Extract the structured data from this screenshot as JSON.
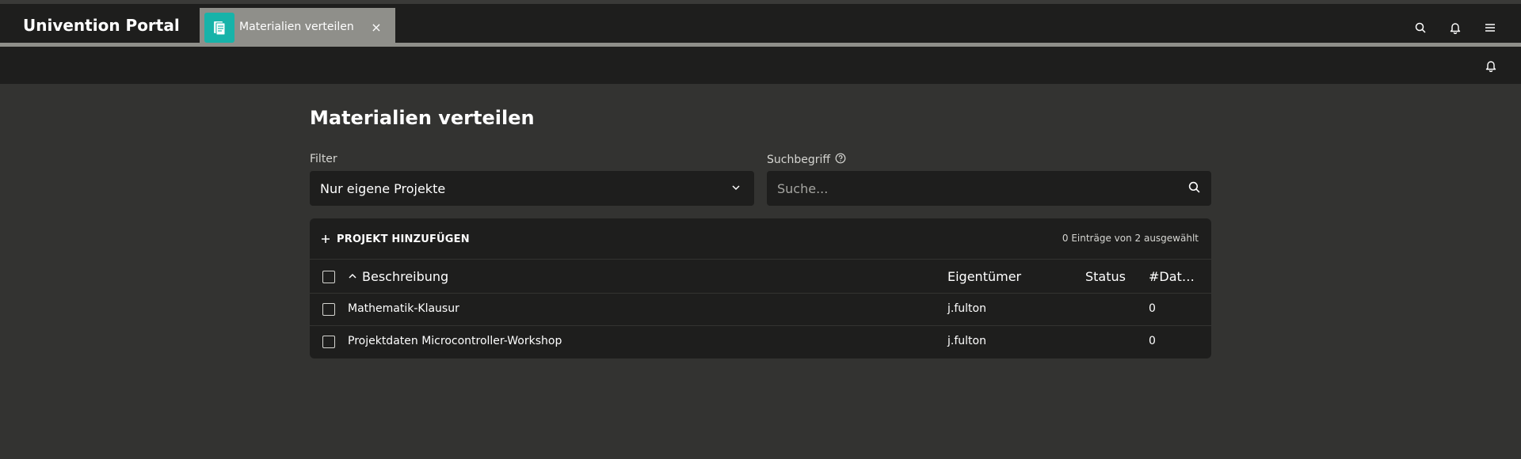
{
  "header": {
    "title": "Univention Portal",
    "tab": {
      "label": "Materialien verteilen",
      "close": "×",
      "icon": "file-icon"
    },
    "icons": [
      "search-icon",
      "bell-icon",
      "menu-icon"
    ]
  },
  "subbar": {
    "icon": "bell-icon"
  },
  "page": {
    "title": "Materialien verteilen"
  },
  "filter": {
    "label": "Filter",
    "value": "Nur eigene Projekte"
  },
  "search": {
    "label": "Suchbegriff",
    "placeholder": "Suche..."
  },
  "grid": {
    "add_button": "PROJEKT HINZUFÜGEN",
    "selection_count": "0 Einträge von 2 ausgewählt",
    "columns": {
      "description": "Beschreibung",
      "owner": "Eigentümer",
      "status": "Status",
      "files": "#Date..."
    },
    "rows": [
      {
        "description": "Mathematik-Klausur",
        "owner": "j.fulton",
        "status": "",
        "files": "0"
      },
      {
        "description": "Projektdaten Microcontroller-Workshop",
        "owner": "j.fulton",
        "status": "",
        "files": "0"
      }
    ]
  },
  "colors": {
    "accent": "#17b3a9",
    "background": "#333331",
    "surface": "#1e1e1d",
    "tab": "#8f8f8a"
  }
}
